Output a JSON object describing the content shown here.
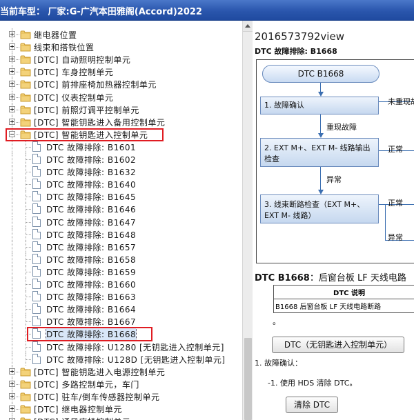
{
  "window": {
    "title": "当前车型： 厂家:G-广汽本田雅阁(Accord)2022"
  },
  "tree": {
    "items": [
      {
        "label": "继电器位置",
        "type": "folder",
        "expander": "plus"
      },
      {
        "label": "线束和搭铁位置",
        "type": "folder",
        "expander": "plus"
      },
      {
        "label": "[DTC] 自动照明控制单元",
        "type": "folder",
        "expander": "plus"
      },
      {
        "label": "[DTC] 车身控制单元",
        "type": "folder",
        "expander": "plus"
      },
      {
        "label": "[DTC] 前排座椅加热器控制单元",
        "type": "folder",
        "expander": "plus"
      },
      {
        "label": "[DTC] 仪表控制单元",
        "type": "folder",
        "expander": "plus"
      },
      {
        "label": "[DTC] 前照灯调平控制单元",
        "type": "folder",
        "expander": "plus"
      },
      {
        "label": "[DTC] 智能钥匙进入备用控制单元",
        "type": "folder",
        "expander": "plus"
      },
      {
        "label": "[DTC] 智能钥匙进入控制单元",
        "type": "folder",
        "expander": "minus"
      },
      {
        "label": "DTC 故障排除: B1601",
        "type": "doc"
      },
      {
        "label": "DTC 故障排除: B1602",
        "type": "doc"
      },
      {
        "label": "DTC 故障排除: B1632",
        "type": "doc"
      },
      {
        "label": "DTC 故障排除: B1640",
        "type": "doc"
      },
      {
        "label": "DTC 故障排除: B1645",
        "type": "doc"
      },
      {
        "label": "DTC 故障排除: B1646",
        "type": "doc"
      },
      {
        "label": "DTC 故障排除: B1647",
        "type": "doc"
      },
      {
        "label": "DTC 故障排除: B1648",
        "type": "doc"
      },
      {
        "label": "DTC 故障排除: B1657",
        "type": "doc"
      },
      {
        "label": "DTC 故障排除: B1658",
        "type": "doc"
      },
      {
        "label": "DTC 故障排除: B1659",
        "type": "doc"
      },
      {
        "label": "DTC 故障排除: B1660",
        "type": "doc"
      },
      {
        "label": "DTC 故障排除: B1663",
        "type": "doc"
      },
      {
        "label": "DTC 故障排除: B1664",
        "type": "doc"
      },
      {
        "label": "DTC 故障排除: B1667",
        "type": "doc"
      },
      {
        "label": "DTC 故障排除: B1668",
        "type": "doc",
        "selected": true
      },
      {
        "label": "DTC 故障排除: U1280 [无钥匙进入控制单元]",
        "type": "doc"
      },
      {
        "label": "DTC 故障排除: U128D [无钥匙进入控制单元]",
        "type": "doc"
      },
      {
        "label": "[DTC] 智能钥匙进入电源控制单元",
        "type": "folder",
        "expander": "plus"
      },
      {
        "label": "[DTC] 多路控制单元，车门",
        "type": "folder",
        "expander": "plus"
      },
      {
        "label": "[DTC] 驻车/倒车传感器控制单元",
        "type": "folder",
        "expander": "plus"
      },
      {
        "label": "[DTC] 继电器控制单元",
        "type": "folder",
        "expander": "plus"
      },
      {
        "label": "[DTC] 通风座椅控制单元",
        "type": "folder",
        "expander": "plus"
      }
    ]
  },
  "content": {
    "doc_id": "2016573792view",
    "subtitle": "DTC 故障排除: B1668",
    "flow": {
      "start": "DTC B1668",
      "step1": "1.  故障确认",
      "step1_right": "未重现故",
      "step1_down": "重现故障",
      "step2": "2.  EXT M+、EXT M- 线路输出检查",
      "step2_right": "正常",
      "step2_down": "异常",
      "step3": "3.  线束断路检查（EXT M+、EXT M- 线路）",
      "step3_right": "正常",
      "step3_bottom": "异常"
    },
    "section_code": "DTC B1668",
    "section_desc": "：后窗台板 LF 天线电路",
    "table": {
      "header": "DTC 说明",
      "row": "B1668 后窗台板 LF 天线电路断路"
    },
    "dot": "。",
    "button_unit": "DTC（无钥匙进入控制单元）",
    "step_confirm": "1.  故障确认：",
    "step_sub": "-1.   使用 HDS 清除 DTC。",
    "button_clear": "清除 DTC"
  },
  "colors": {
    "title_bar": "#2a56ad",
    "highlight_box": "#e01c22",
    "flow_fill": "#c6d8ef",
    "flow_line": "#3c6fb1"
  }
}
